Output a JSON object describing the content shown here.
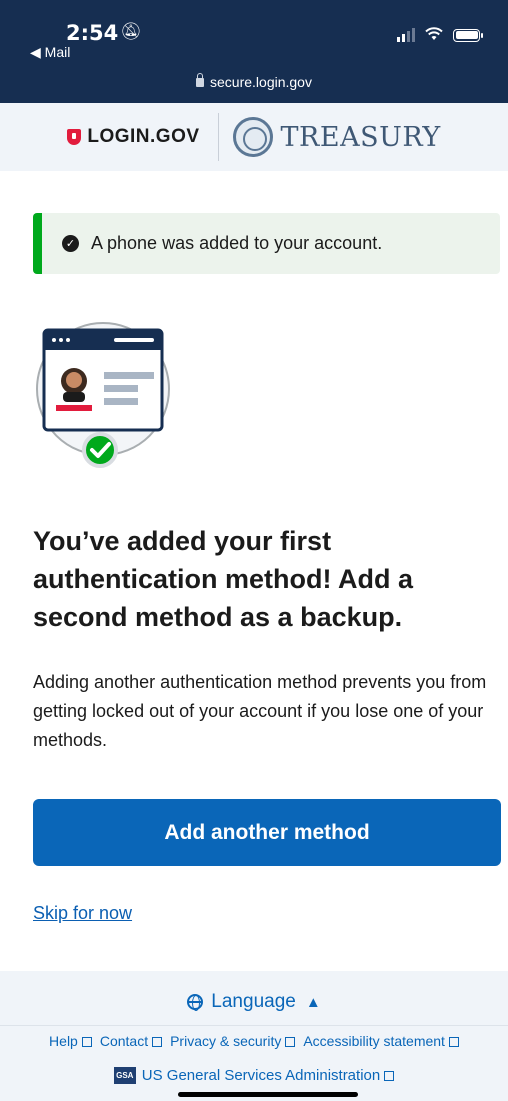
{
  "status_bar": {
    "time": "2:54",
    "back_app": "◀ Mail"
  },
  "browser": {
    "url": "secure.login.gov"
  },
  "partner_header": {
    "login_logo": "LOGIN.GOV",
    "agency": "TREASURY"
  },
  "alert": {
    "message": "A phone was added to your account."
  },
  "main": {
    "heading": "You’ve added your first authentication method! Add a second method as a backup.",
    "description": "Adding another authentication method prevents you from getting locked out of your account if you lose one of your methods.",
    "primary_button": "Add another method",
    "skip_link": "Skip for now"
  },
  "footer": {
    "language_label": "Language",
    "links": [
      {
        "label": "Help"
      },
      {
        "label": "Contact"
      },
      {
        "label": "Privacy & security"
      },
      {
        "label": "Accessibility statement"
      }
    ],
    "gsa_badge": "GSA",
    "gsa_label": "US General Services Administration"
  },
  "colors": {
    "header_bg": "#162e51",
    "primary": "#0a66b8",
    "success_border": "#00a91c",
    "alert_bg": "#ecf3ec",
    "brand_red": "#e21c3d"
  },
  "icons": [
    "bell-slash-icon",
    "signal-icon",
    "wifi-icon",
    "battery-icon",
    "lock-icon",
    "shield-icon",
    "seal-icon",
    "check-circle-icon",
    "globe-icon",
    "caret-up-icon",
    "external-link-icon"
  ]
}
